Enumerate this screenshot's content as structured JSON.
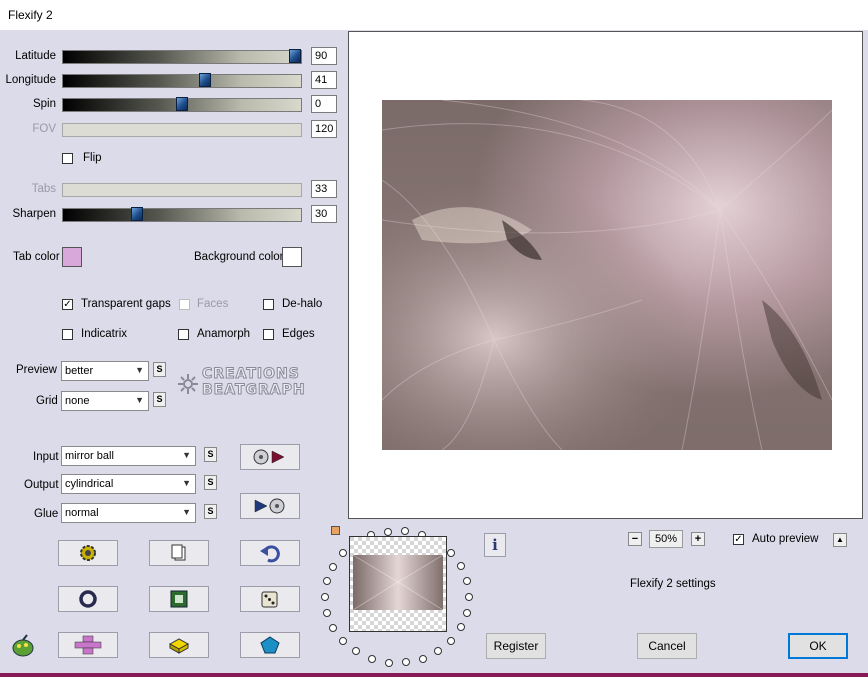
{
  "window": {
    "title": "Flexify 2"
  },
  "sliders": [
    {
      "label": "Latitude",
      "value": "90",
      "level": 1.0,
      "disabled": false
    },
    {
      "label": "Longitude",
      "value": "41",
      "level": 0.6,
      "disabled": false
    },
    {
      "label": "Spin",
      "value": "0",
      "level": 0.5,
      "disabled": false
    },
    {
      "label": "FOV",
      "value": "120",
      "level": null,
      "disabled": true
    },
    {
      "label": "Tabs",
      "value": "33",
      "level": null,
      "disabled": true
    },
    {
      "label": "Sharpen",
      "value": "30",
      "level": 0.3,
      "disabled": false
    }
  ],
  "flip": {
    "label": "Flip",
    "checked": false
  },
  "colors": {
    "tab_color_label": "Tab color",
    "tab_color": "#d7a8d9",
    "background_color_label": "Background color",
    "background_color": "#ffffff"
  },
  "options": {
    "transparent_gaps": {
      "label": "Transparent gaps",
      "checked": true
    },
    "faces": {
      "label": "Faces",
      "checked": false
    },
    "de_halo": {
      "label": "De-halo",
      "checked": false
    },
    "indicatrix": {
      "label": "Indicatrix",
      "checked": false
    },
    "anamorph": {
      "label": "Anamorph",
      "checked": false
    },
    "edges": {
      "label": "Edges",
      "checked": false
    }
  },
  "preview_select": {
    "label": "Preview",
    "value": "better"
  },
  "grid_select": {
    "label": "Grid",
    "value": "none"
  },
  "watermark": {
    "line1": "CREATIONS",
    "line2": "BEATGRAPH"
  },
  "input_select": {
    "label": "Input",
    "value": "mirror ball"
  },
  "output_select": {
    "label": "Output",
    "value": "cylindrical"
  },
  "glue_select": {
    "label": "Glue",
    "value": "normal"
  },
  "s_button": "S",
  "zoom": {
    "minus": "−",
    "value": "50%",
    "plus": "+"
  },
  "auto_preview": {
    "label": "Auto preview",
    "checked": true,
    "toggle": "▲"
  },
  "settings_name": "Flexify 2 settings",
  "buttons": {
    "register": "Register",
    "cancel": "Cancel",
    "ok": "OK",
    "info": "i"
  },
  "accent_colors": {
    "slider_thumb": "#1e4c8c",
    "default_button_border": "#0078d7",
    "dialog_background": "#dcdbe9"
  }
}
